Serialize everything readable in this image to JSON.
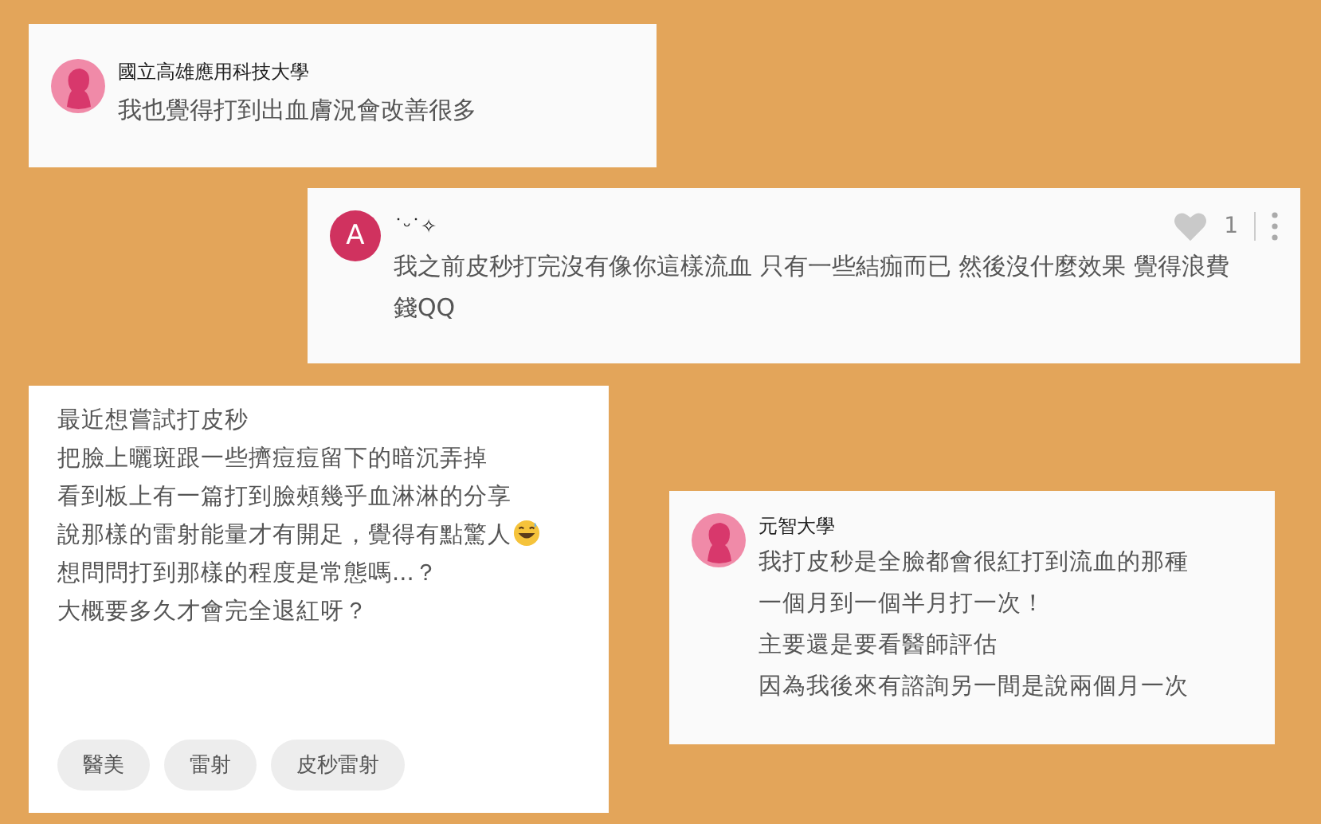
{
  "comments": [
    {
      "kind": "reply",
      "author": "國立高雄應用科技大學",
      "avatar": {
        "kind": "silhouette"
      },
      "text": "我也覺得打到出血膚況會改善很多"
    },
    {
      "kind": "comment",
      "author": "˙ᵕ˙✧",
      "avatar": {
        "kind": "letter",
        "letter": "A"
      },
      "text": "我之前皮秒打完沒有像你這樣流血 只有一些結痂而已 然後沒什麼效果 覺得浪費錢QQ",
      "likes": {
        "count": "1",
        "liked": false
      }
    },
    {
      "kind": "post",
      "lines": [
        {
          "text": "最近想嘗試打皮秒",
          "emoji": false
        },
        {
          "text": "把臉上曬斑跟一些擠痘痘留下的暗沉弄掉",
          "emoji": false
        },
        {
          "text": "看到板上有一篇打到臉頰幾乎血淋淋的分享",
          "emoji": false
        },
        {
          "text": "說那樣的雷射能量才有開足，覺得有點驚人",
          "emoji": true
        },
        {
          "text": "想問問打到那樣的程度是常態嗎...？",
          "emoji": false
        },
        {
          "text": "大概要多久才會完全退紅呀？",
          "emoji": false
        }
      ],
      "tags": [
        "醫美",
        "雷射",
        "皮秒雷射"
      ]
    },
    {
      "kind": "reply",
      "author": "元智大學",
      "avatar": {
        "kind": "silhouette"
      },
      "lines": [
        "我打皮秒是全臉都會很紅打到流血的那種",
        "一個月到一個半月打一次！",
        "主要還是要看醫師評估",
        "因為我後來有諮詢另一間是說兩個月一次"
      ]
    }
  ]
}
